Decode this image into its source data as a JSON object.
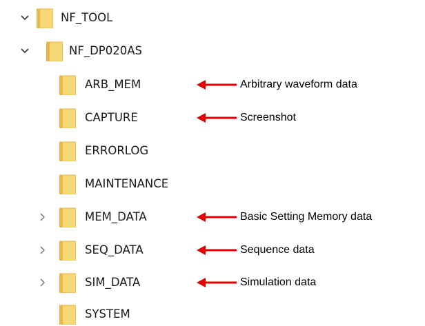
{
  "tree": {
    "root": {
      "label": "NF_TOOL",
      "expanded": true
    },
    "child": {
      "label": "NF_DP020AS",
      "expanded": true
    },
    "items": [
      {
        "label": "ARB_MEM",
        "expandable": false
      },
      {
        "label": "CAPTURE",
        "expandable": false
      },
      {
        "label": "ERRORLOG",
        "expandable": false
      },
      {
        "label": "MAINTENANCE",
        "expandable": false
      },
      {
        "label": "MEM_DATA",
        "expandable": true
      },
      {
        "label": "SEQ_DATA",
        "expandable": true
      },
      {
        "label": "SIM_DATA",
        "expandable": true
      },
      {
        "label": "SYSTEM",
        "expandable": false
      }
    ]
  },
  "annotations": [
    {
      "target": "ARB_MEM",
      "text": "Arbitrary waveform data"
    },
    {
      "target": "CAPTURE",
      "text": "Screenshot"
    },
    {
      "target": "MEM_DATA",
      "text": "Basic Setting Memory data"
    },
    {
      "target": "SEQ_DATA",
      "text": "Sequence data"
    },
    {
      "target": "SIM_DATA",
      "text": "Simulation data"
    }
  ],
  "icons": {
    "folder": "folder-icon",
    "expanded": "chevron-down-icon",
    "collapsed": "chevron-right-icon"
  },
  "colors": {
    "folder_fill": "#f8d775",
    "folder_tab": "#e9b84a",
    "arrow": "#e00000",
    "chevron": "#7a7a7a"
  }
}
